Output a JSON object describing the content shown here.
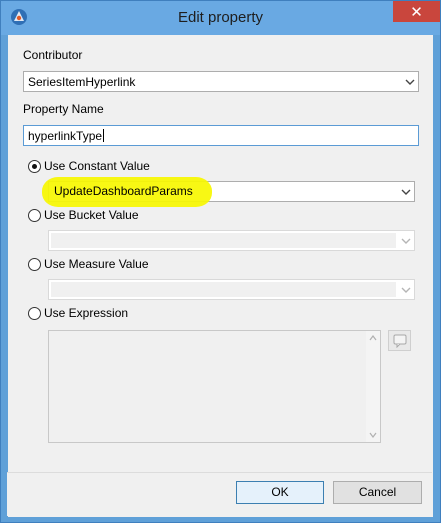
{
  "window": {
    "title": "Edit property",
    "close_label": "✕"
  },
  "contributor": {
    "label": "Contributor",
    "selected": "SeriesItemHyperlink"
  },
  "property_name": {
    "label": "Property Name",
    "value": "hyperlinkType"
  },
  "options": {
    "constant": {
      "label": "Use Constant Value",
      "selected": true,
      "value": "UpdateDashboardParams"
    },
    "bucket": {
      "label": "Use Bucket Value",
      "selected": false,
      "value": ""
    },
    "measure": {
      "label": "Use Measure Value",
      "selected": false,
      "value": ""
    },
    "expression": {
      "label": "Use Expression",
      "selected": false,
      "value": ""
    }
  },
  "buttons": {
    "ok": "OK",
    "cancel": "Cancel"
  },
  "colors": {
    "title_bar": "#69a9e3",
    "close_button": "#c9463d",
    "highlight": "#f7f700",
    "focus_border": "#5b9bd5"
  },
  "icons": {
    "app": "app-icon",
    "close": "close-icon",
    "dropdown": "chevron-down-icon",
    "expression_editor": "expression-editor-icon"
  }
}
